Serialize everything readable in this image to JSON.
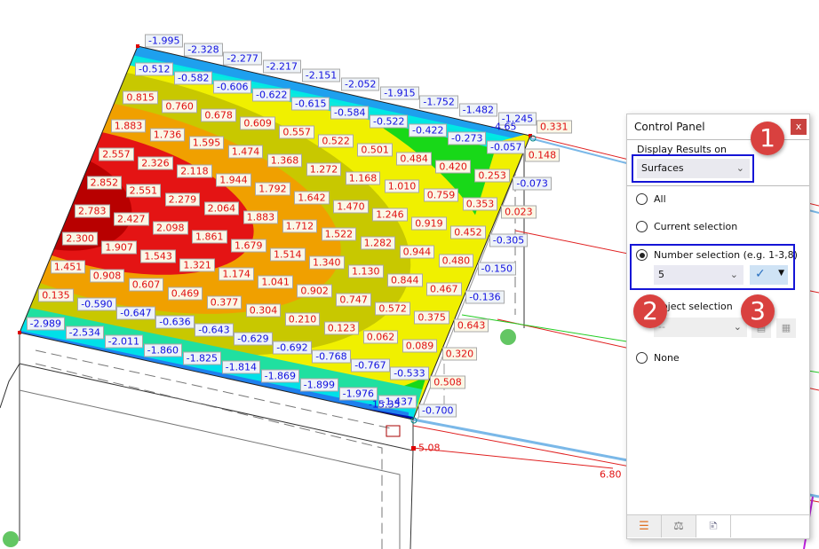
{
  "viewport": {
    "top_edge_labels": [
      "-1.995",
      "-2.328",
      "-2.277",
      "-2.217",
      "-2.151",
      "-2.052",
      "-1.915",
      "-1.752",
      "-1.482",
      "-1.245"
    ],
    "corner_label": "-4.65",
    "grid_labels": [
      [
        "-0.512",
        "-0.582",
        "-0.606",
        "-0.622",
        "-0.615",
        "-0.584",
        "-0.522",
        "-0.422",
        "-0.273",
        "-0.057"
      ],
      [
        "0.815",
        "0.760",
        "0.678",
        "0.609",
        "0.557",
        "0.522",
        "0.501",
        "0.484",
        "0.420",
        "0.253"
      ],
      [
        "1.883",
        "1.736",
        "1.595",
        "1.474",
        "1.368",
        "1.272",
        "1.168",
        "1.010",
        "0.759",
        "0.353"
      ],
      [
        "2.557",
        "2.326",
        "2.118",
        "1.944",
        "1.792",
        "1.642",
        "1.470",
        "1.246",
        "0.919",
        "0.452"
      ],
      [
        "2.852",
        "2.551",
        "2.279",
        "2.064",
        "1.883",
        "1.712",
        "1.522",
        "1.282",
        "0.944",
        "0.480"
      ],
      [
        "2.783",
        "2.427",
        "2.098",
        "1.861",
        "1.679",
        "1.514",
        "1.340",
        "1.130",
        "0.844",
        "0.467"
      ],
      [
        "2.300",
        "1.907",
        "1.543",
        "1.321",
        "1.174",
        "1.041",
        "0.902",
        "0.747",
        "0.572",
        "0.375"
      ],
      [
        "1.451",
        "0.908",
        "0.607",
        "0.469",
        "0.377",
        "0.304",
        "0.210",
        "0.123",
        "0.062",
        "0.089"
      ],
      [
        "0.135",
        "-0.590",
        "-0.647",
        "-0.636",
        "-0.643",
        "-0.629",
        "-0.692",
        "-0.768",
        "-0.767",
        "-0.533"
      ],
      [
        "-2.989",
        "-2.534",
        "-2.011",
        "-1.860",
        "-1.825",
        "-1.814",
        "-1.869",
        "-1.899",
        "-1.976",
        "-1.437"
      ]
    ],
    "bottom_corner_overlay": "-15.35",
    "right_edge_labels": [
      "0.331",
      "0.148",
      "-0.073",
      "0.023",
      "-0.305",
      "-0.150",
      "-0.136",
      "0.643",
      "0.320",
      "0.508",
      "-0.700"
    ],
    "member_labels": [
      "5.08",
      "6.80"
    ],
    "colors": {
      "positive": "#e01010",
      "negative": "#1010e0"
    }
  },
  "control_panel": {
    "title": "Control Panel",
    "close_label": "x",
    "display_results_label": "Display Results on",
    "display_results_value": "Surfaces",
    "options": {
      "all": "All",
      "current_selection": "Current selection",
      "number_selection": "Number selection (e.g. 1-3,8)",
      "object_selection": "Object selection",
      "none": "None"
    },
    "selected_option": "number_selection",
    "number_value": "5",
    "object_value": "--",
    "badges": [
      "1",
      "2",
      "3"
    ],
    "tabs": [
      "color-scale-icon",
      "balance-icon",
      "display-properties-icon"
    ],
    "highlight_color": "#1515d6"
  }
}
